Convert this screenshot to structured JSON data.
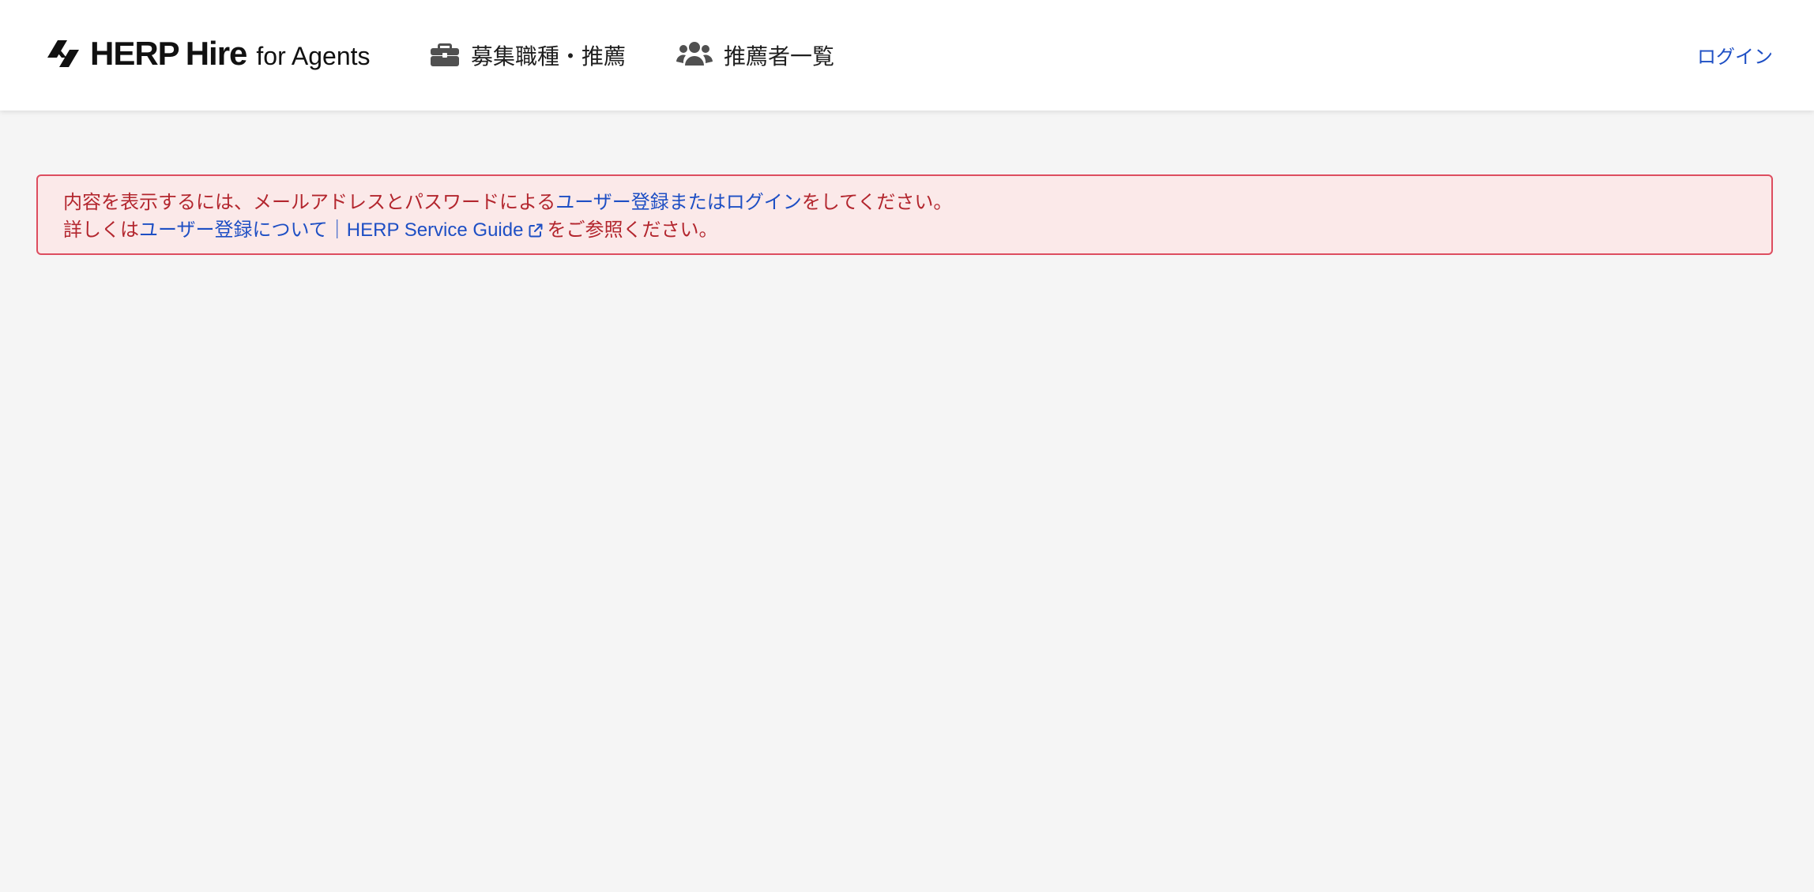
{
  "header": {
    "logo": {
      "brand": "HERP",
      "brand_second": "Hire",
      "suffix": "for Agents"
    },
    "nav": {
      "jobs_label": "募集職種・推薦",
      "candidates_label": "推薦者一覧"
    },
    "login_label": "ログイン"
  },
  "alert": {
    "line1_prefix": "内容を表示するには、メールアドレスとパスワードによる",
    "line1_link": "ユーザー登録またはログイン",
    "line1_suffix": "をしてください。",
    "line2_prefix": "詳しくは",
    "line2_link": "ユーザー登録について｜HERP Service Guide",
    "line2_suffix": "をご参照ください。"
  },
  "colors": {
    "background": "#f5f5f5",
    "header_bg": "#ffffff",
    "link_blue": "#1e4fc4",
    "alert_text": "#b3262e",
    "alert_border": "#dd4d5f",
    "alert_bg": "#fbe9e9"
  },
  "icons": {
    "logo": "herp-logo-mark",
    "jobs": "briefcase-icon",
    "candidates": "users-icon",
    "external": "external-link-icon"
  }
}
